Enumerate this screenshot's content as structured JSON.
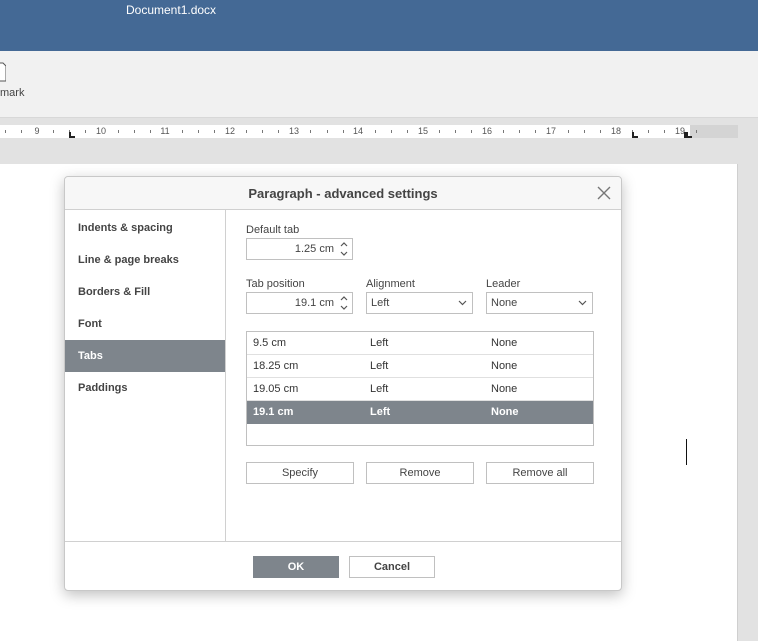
{
  "app": {
    "document_title": "Document1.docx"
  },
  "toolbar": {
    "bookmark_label": "mark",
    "bookmark_icon": "bookmark-icon"
  },
  "ruler": {
    "numbers": [
      "9",
      "10",
      "11",
      "12",
      "13",
      "14",
      "15",
      "16",
      "17",
      "18",
      "19"
    ]
  },
  "dialog": {
    "title": "Paragraph - advanced settings",
    "close_icon": "close-icon",
    "sidebar": {
      "items": [
        {
          "label": "Indents & spacing"
        },
        {
          "label": "Line & page breaks"
        },
        {
          "label": "Borders & Fill"
        },
        {
          "label": "Font"
        },
        {
          "label": "Tabs"
        },
        {
          "label": "Paddings"
        }
      ],
      "active": "Tabs"
    },
    "tabs_panel": {
      "default_tab_label": "Default tab",
      "default_tab_value": "1.25 cm",
      "tab_position_label": "Tab position",
      "tab_position_value": "19.1 cm",
      "alignment_label": "Alignment",
      "alignment_value": "Left",
      "leader_label": "Leader",
      "leader_value": "None",
      "rows": [
        {
          "position": "9.5 cm",
          "alignment": "Left",
          "leader": "None"
        },
        {
          "position": "18.25 cm",
          "alignment": "Left",
          "leader": "None"
        },
        {
          "position": "19.05 cm",
          "alignment": "Left",
          "leader": "None"
        },
        {
          "position": "19.1 cm",
          "alignment": "Left",
          "leader": "None"
        }
      ],
      "selected_row": "19.1 cm",
      "specify_label": "Specify",
      "remove_label": "Remove",
      "remove_all_label": "Remove all"
    },
    "footer": {
      "ok_label": "OK",
      "cancel_label": "Cancel"
    }
  },
  "colors": {
    "titlebar": "#446995",
    "selected": "#7e858c"
  }
}
